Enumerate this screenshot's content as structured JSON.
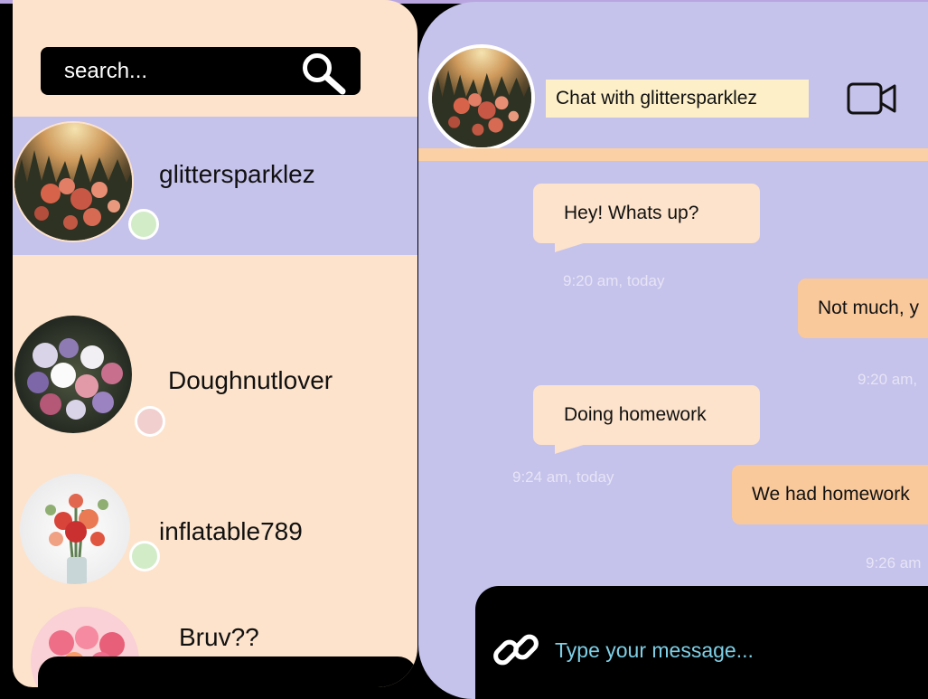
{
  "search": {
    "placeholder": "search..."
  },
  "contacts": [
    {
      "name": "glittersparklez",
      "status_color": "#d2ecc8",
      "active": true
    },
    {
      "name": "Doughnutlover",
      "status_color": "#f2cfcf",
      "active": false
    },
    {
      "name": "inflatable789",
      "status_color": "#d2ecc8",
      "active": false
    },
    {
      "name": "Bruv??",
      "active": false
    }
  ],
  "chat": {
    "title": "Chat with glittersparklez",
    "messages": [
      {
        "direction": "received",
        "text": "Hey! Whats up?",
        "time": "9:20 am, today"
      },
      {
        "direction": "sent",
        "text": "Not much, y",
        "time": "9:20 am,"
      },
      {
        "direction": "received",
        "text": "Doing homework",
        "time": "9:24 am, today"
      },
      {
        "direction": "sent",
        "text": "We had homework",
        "time": "9:26 am"
      }
    ],
    "composer": {
      "placeholder": "Type your message..."
    }
  },
  "colors": {
    "contacts_bg": "#fde3cb",
    "chat_bg": "#c5c2eb",
    "active_contact": "#c5c2eb",
    "sent_bubble": "#f9c99c",
    "received_bubble": "#fde3cb",
    "title_bg": "#fdf0c9",
    "composer_text": "#7ecfe6"
  },
  "icons": {
    "search": "search-icon",
    "video": "video-camera-icon",
    "attach": "link-icon"
  }
}
